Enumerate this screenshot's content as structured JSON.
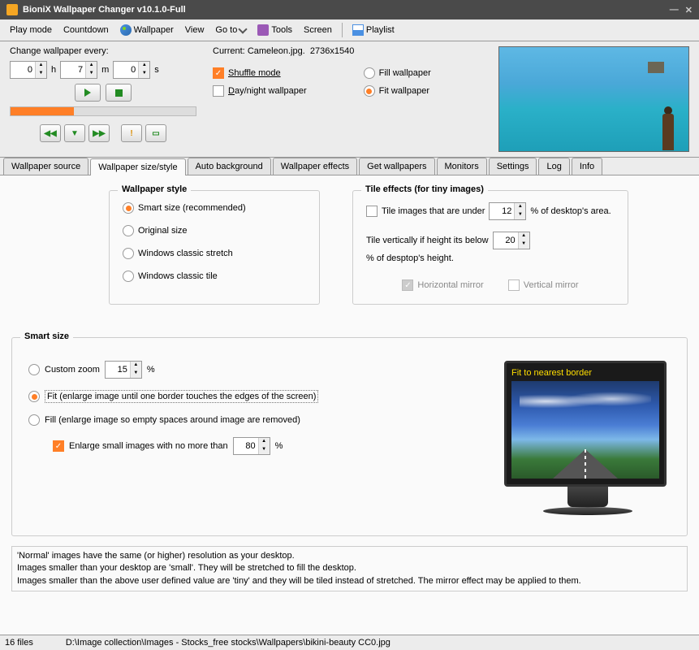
{
  "title": "BioniX Wallpaper Changer v10.1.0-Full",
  "menu": [
    "Play mode",
    "Countdown",
    "Wallpaper",
    "View",
    "Go to",
    "Tools",
    "Screen",
    "Playlist"
  ],
  "change": {
    "label": "Change wallpaper every:",
    "h": "0",
    "hunit": "h",
    "m": "7",
    "munit": "m",
    "s": "0",
    "sunit": "s"
  },
  "current": {
    "label": "Current:",
    "file": "Cameleon.jpg.",
    "size": "2736x1540"
  },
  "opts": {
    "shuffle": "Shuffle mode",
    "daynight": "Day/night wallpaper",
    "fill": "Fill wallpaper",
    "fit": "Fit wallpaper"
  },
  "tabs": [
    "Wallpaper source",
    "Wallpaper size/style",
    "Auto background",
    "Wallpaper effects",
    "Get wallpapers",
    "Monitors",
    "Settings",
    "Log",
    "Info"
  ],
  "ws": {
    "title": "Wallpaper style",
    "smart": "Smart size (recommended)",
    "orig": "Original size",
    "stretch": "Windows classic stretch",
    "tile": "Windows classic tile"
  },
  "tile": {
    "title": "Tile effects (for tiny images)",
    "under1": "Tile images that are under",
    "under2": "% of desktop's area.",
    "underval": "12",
    "vert1": "Tile vertically if height its below",
    "vert2": "% of desptop's height.",
    "vertval": "20",
    "hmirror": "Horizontal mirror",
    "vmirror": "Vertical mirror"
  },
  "smart": {
    "title": "Smart size",
    "custom": "Custom zoom",
    "customval": "15",
    "custompct": "%",
    "fit": "Fit (enlarge image until one border touches the edges of the screen)",
    "fill": "Fill (enlarge image so empty spaces around image are removed)",
    "enlarge": "Enlarge small images with no more than",
    "enlargeval": "80",
    "enlargepct": "%",
    "monitor": "Fit to nearest border"
  },
  "help": {
    "l1": "'Normal' images have the same (or higher) resolution as your desktop.",
    "l2": "Images smaller than your desktop are 'small'. They will be stretched to fill the desktop.",
    "l3": "Images smaller than the above user defined value are 'tiny' and they will be tiled instead of stretched. The mirror effect may be applied to them."
  },
  "status": {
    "files": "16 files",
    "path": "D:\\Image collection\\Images - Stocks_free stocks\\Wallpapers\\bikini-beauty CC0.jpg"
  }
}
